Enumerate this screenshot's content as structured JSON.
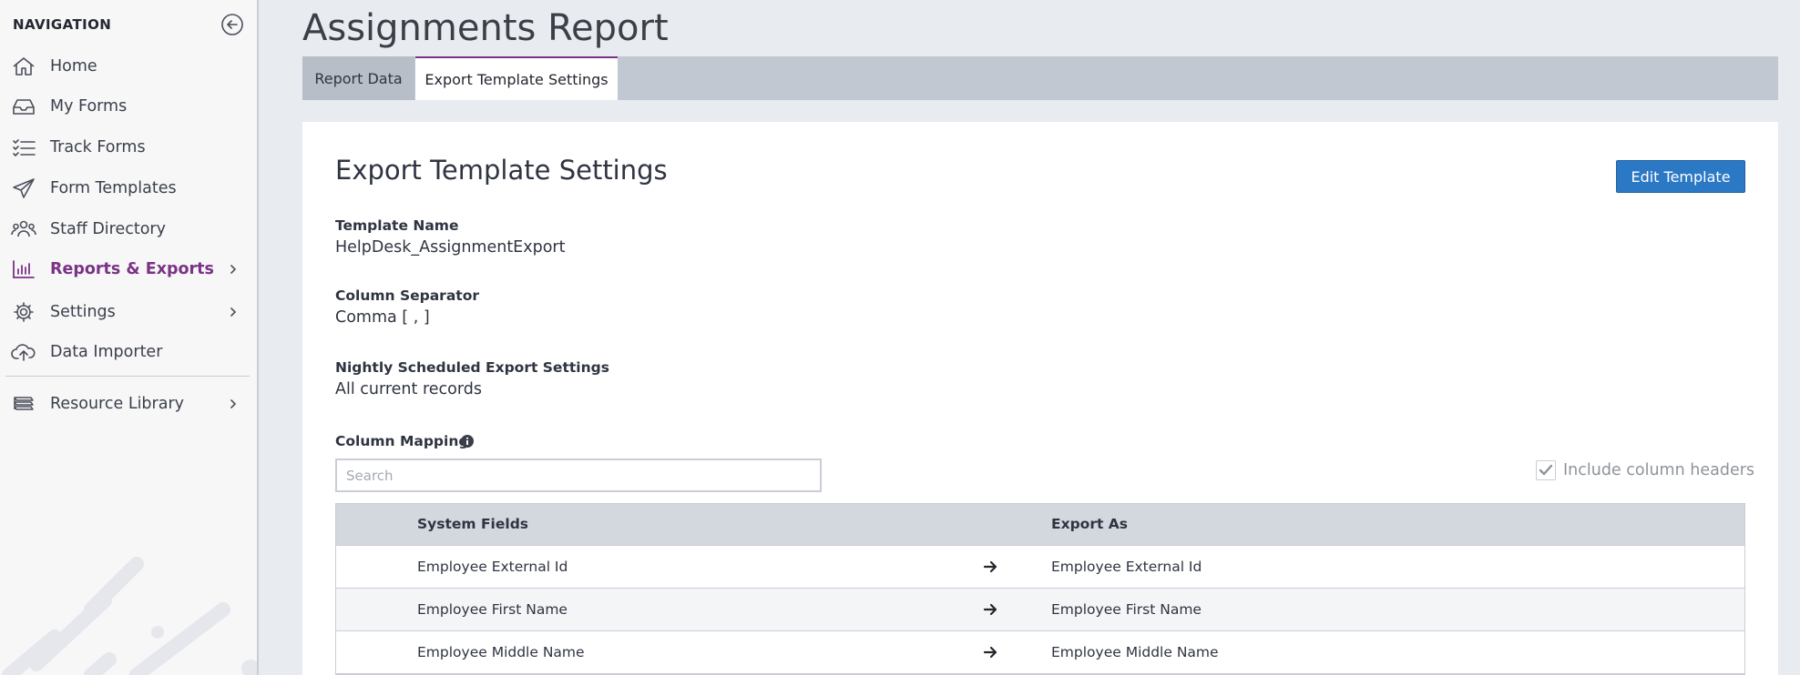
{
  "sidebar": {
    "header": "NAVIGATION",
    "items": [
      {
        "label": "Home",
        "icon": "home-icon"
      },
      {
        "label": "My Forms",
        "icon": "inbox-icon"
      },
      {
        "label": "Track Forms",
        "icon": "checklist-icon"
      },
      {
        "label": "Form Templates",
        "icon": "paper-plane-icon"
      },
      {
        "label": "Staff Directory",
        "icon": "users-icon"
      },
      {
        "label": "Reports & Exports",
        "icon": "bar-chart-icon",
        "active": true,
        "has_children": true
      },
      {
        "label": "Settings",
        "icon": "gear-icon",
        "has_children": true
      },
      {
        "label": "Data Importer",
        "icon": "cloud-upload-icon"
      },
      {
        "label": "Resource Library",
        "icon": "library-icon",
        "has_children": true
      }
    ],
    "accent_color": "#7b3385"
  },
  "page": {
    "title": "Assignments Report",
    "tabs": [
      {
        "label": "Report Data",
        "active": false
      },
      {
        "label": "Export Template Settings",
        "active": true
      }
    ]
  },
  "panel": {
    "title": "Export Template Settings",
    "edit_button": "Edit Template",
    "fields": [
      {
        "label": "Template Name",
        "value": "HelpDesk_AssignmentExport"
      },
      {
        "label": "Column Separator",
        "value": "Comma [ , ]"
      },
      {
        "label": "Nightly Scheduled Export Settings",
        "value": "All current records"
      }
    ],
    "column_mapping": {
      "label": "Column Mapping",
      "search_placeholder": "Search",
      "include_headers_label": "Include column headers",
      "include_headers_checked": true,
      "headers": [
        "System Fields",
        "Export As"
      ],
      "rows": [
        [
          "Employee External Id",
          "Employee External Id"
        ],
        [
          "Employee First Name",
          "Employee First Name"
        ],
        [
          "Employee Middle Name",
          "Employee Middle Name"
        ]
      ]
    }
  },
  "colors": {
    "primary_button": "#2b78c5",
    "active_tab_border": "#7b3385"
  }
}
